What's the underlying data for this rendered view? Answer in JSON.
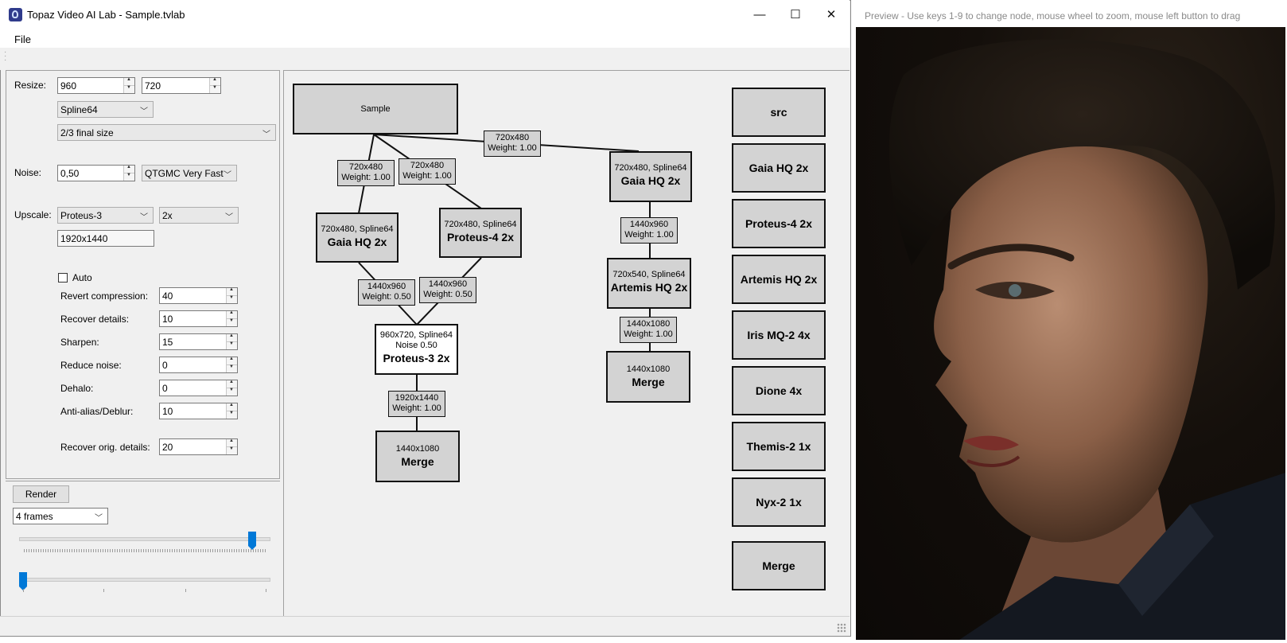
{
  "window": {
    "title": "Topaz Video AI Lab - Sample.tvlab",
    "minimize": "—",
    "maximize": "☐",
    "close": "✕"
  },
  "menu": {
    "file": "File"
  },
  "settings": {
    "resize_label": "Resize:",
    "resize_w": "960",
    "resize_h": "720",
    "resize_filter": "Spline64",
    "resize_mode": "2/3 final size",
    "noise_label": "Noise:",
    "noise_value": "0,50",
    "noise_method": "QTGMC Very Fast",
    "upscale_label": "Upscale:",
    "upscale_model": "Proteus-3",
    "upscale_factor": "2x",
    "upscale_output": "1920x1440",
    "auto_label": "Auto",
    "params": [
      {
        "label": "Revert compression:",
        "value": "40"
      },
      {
        "label": "Recover details:",
        "value": "10"
      },
      {
        "label": "Sharpen:",
        "value": "15"
      },
      {
        "label": "Reduce noise:",
        "value": "0"
      },
      {
        "label": "Dehalo:",
        "value": "0"
      },
      {
        "label": "Anti-alias/Deblur:",
        "value": "10"
      }
    ],
    "recover_orig_label": "Recover orig. details:",
    "recover_orig_value": "20"
  },
  "render": {
    "button": "Render",
    "frames": "4 frames"
  },
  "graph": {
    "sample": "Sample",
    "nodes": {
      "gaia_left": {
        "sub": "720x480, Spline64",
        "title": "Gaia HQ 2x"
      },
      "proteus4": {
        "sub": "720x480, Spline64",
        "title": "Proteus-4 2x"
      },
      "gaia_right": {
        "sub": "720x480, Spline64",
        "title": "Gaia HQ 2x"
      },
      "artemis": {
        "sub": "720x540, Spline64",
        "title": "Artemis HQ 2x"
      },
      "proteus3": {
        "sub": "960x720, Spline64",
        "sub2": "Noise 0.50",
        "title": "Proteus-3 2x"
      },
      "merge_left": {
        "sub": "1440x1080",
        "title": "Merge"
      },
      "merge_right": {
        "sub": "1440x1080",
        "title": "Merge"
      }
    },
    "edges": {
      "e_top": {
        "res": "720x480",
        "w": "Weight: 1.00"
      },
      "e_gaia": {
        "res": "720x480",
        "w": "Weight: 1.00"
      },
      "e_prot4": {
        "res": "720x480",
        "w": "Weight: 1.00"
      },
      "e_gaia_art": {
        "res": "1440x960",
        "w": "Weight: 1.00"
      },
      "e_gaia_p3": {
        "res": "1440x960",
        "w": "Weight: 0.50"
      },
      "e_p4_p3": {
        "res": "1440x960",
        "w": "Weight: 0.50"
      },
      "e_art_merge": {
        "res": "1440x1080",
        "w": "Weight: 1.00"
      },
      "e_p3_merge": {
        "res": "1920x1440",
        "w": "Weight: 1.00"
      }
    },
    "models": [
      "src",
      "Gaia HQ 2x",
      "Proteus-4 2x",
      "Artemis HQ 2x",
      "Iris MQ-2 4x",
      "Dione 4x",
      "Themis-2 1x",
      "Nyx-2 1x"
    ],
    "merge_button": "Merge"
  },
  "preview": {
    "title": "Preview - Use keys 1-9 to change node, mouse wheel to zoom,  mouse left button to drag"
  },
  "colors": {
    "accent": "#0078d7",
    "node_fill": "#d3d3d3",
    "panel_bg": "#f0f0f0"
  },
  "icons": {
    "app": "topaz-app-icon",
    "grip": "toolbar-grip-icon",
    "size": "size-grip-icon"
  }
}
